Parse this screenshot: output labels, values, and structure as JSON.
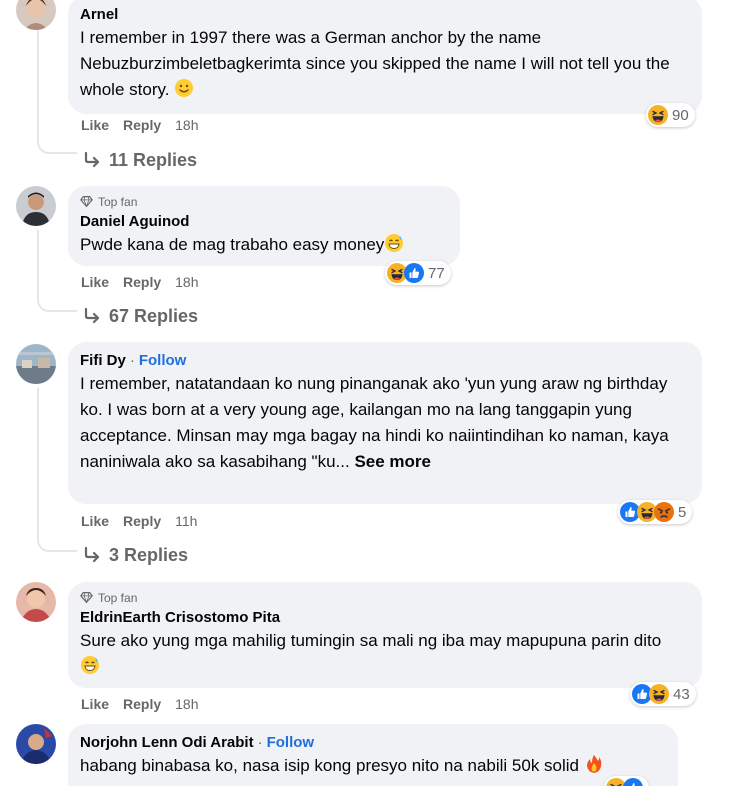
{
  "comments": [
    {
      "author": "Arnel",
      "badge": "",
      "follow": "",
      "text": "I remember in 1997 there was a German anchor by the name Nebuzburzimbeletbagkerimta since you skipped the name I will not tell you the whole story.",
      "see_more": "",
      "text_emoji": "slightly-smiling-face",
      "like": "Like",
      "reply": "Reply",
      "time": "18h",
      "reaction_icons": [
        "haha"
      ],
      "reaction_count": "90",
      "replies": "11 Replies"
    },
    {
      "author": "Daniel Aguinod",
      "badge": "Top fan",
      "follow": "",
      "text": "Pwde kana de mag trabaho easy money",
      "see_more": "",
      "text_emoji": "grinning-sweat-face",
      "like": "Like",
      "reply": "Reply",
      "time": "18h",
      "reaction_icons": [
        "haha",
        "like"
      ],
      "reaction_count": "77",
      "replies": "67 Replies"
    },
    {
      "author": "Fifi Dy",
      "badge": "",
      "follow": "Follow",
      "text": "I remember, natatandaan ko nung pinanganak ako 'yun yung araw ng birthday ko. I was born at a very young age, kailangan mo na lang tanggapin yung acceptance. Minsan may mga bagay na hindi ko naiintindihan ko naman, kaya naniniwala ako sa kasabihang \"ku...",
      "see_more": "See more",
      "text_emoji": "",
      "like": "Like",
      "reply": "Reply",
      "time": "11h",
      "reaction_icons": [
        "like",
        "haha",
        "angry"
      ],
      "reaction_count": "5",
      "replies": "3 Replies"
    },
    {
      "author": "EldrinEarth Crisostomo Pita",
      "badge": "Top fan",
      "follow": "",
      "text": "Sure ako yung mga mahilig tumingin sa mali ng iba may mapupuna parin dito",
      "see_more": "",
      "text_emoji": "grinning-sweat-face",
      "like": "Like",
      "reply": "Reply",
      "time": "18h",
      "reaction_icons": [
        "like",
        "haha"
      ],
      "reaction_count": "43",
      "replies": ""
    },
    {
      "author": "Norjohn Lenn Odi Arabit",
      "badge": "",
      "follow": "Follow",
      "text": "habang binabasa ko, nasa isip kong presyo nito na nabili 50k solid",
      "see_more": "",
      "text_emoji": "fire",
      "like": "",
      "reply": "",
      "time": "",
      "reaction_icons": [
        "haha",
        "like"
      ],
      "reaction_count": "",
      "replies": ""
    }
  ],
  "separator": "·",
  "colors": {
    "bubble": "#f0f2f5",
    "secondary_text": "#65676b",
    "follow_link": "#216fdb",
    "thread_line": "#e4e6eb"
  }
}
